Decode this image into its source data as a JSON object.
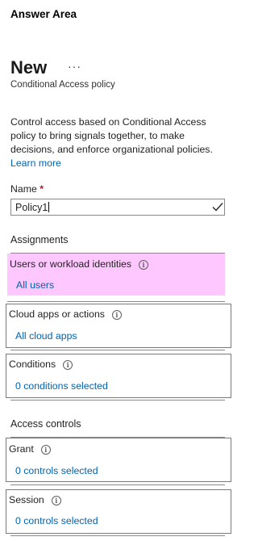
{
  "answer_area": "Answer Area",
  "page": {
    "title": "New",
    "more": "···",
    "subtitle": "Conditional Access policy",
    "description": "Control access based on Conditional Access policy to bring signals together, to make decisions, and enforce organizational policies.",
    "learn_more": "Learn more"
  },
  "name_field": {
    "label": "Name",
    "required_mark": "*",
    "value": "Policy1"
  },
  "assignments": {
    "header": "Assignments",
    "users": {
      "label": "Users or workload identities",
      "value": "All users"
    },
    "cloud_apps": {
      "label": "Cloud apps or actions",
      "value": "All cloud apps"
    },
    "conditions": {
      "label": "Conditions",
      "value": "0 conditions selected"
    }
  },
  "access_controls": {
    "header": "Access controls",
    "grant": {
      "label": "Grant",
      "value": "0 controls selected"
    },
    "session": {
      "label": "Session",
      "value": "0 controls selected"
    }
  },
  "icons": {
    "info": "info-circle-icon",
    "check": "checkmark-icon"
  },
  "colors": {
    "link": "#0063b1",
    "highlight": "#ffc7ff",
    "required": "#c50f1f"
  }
}
